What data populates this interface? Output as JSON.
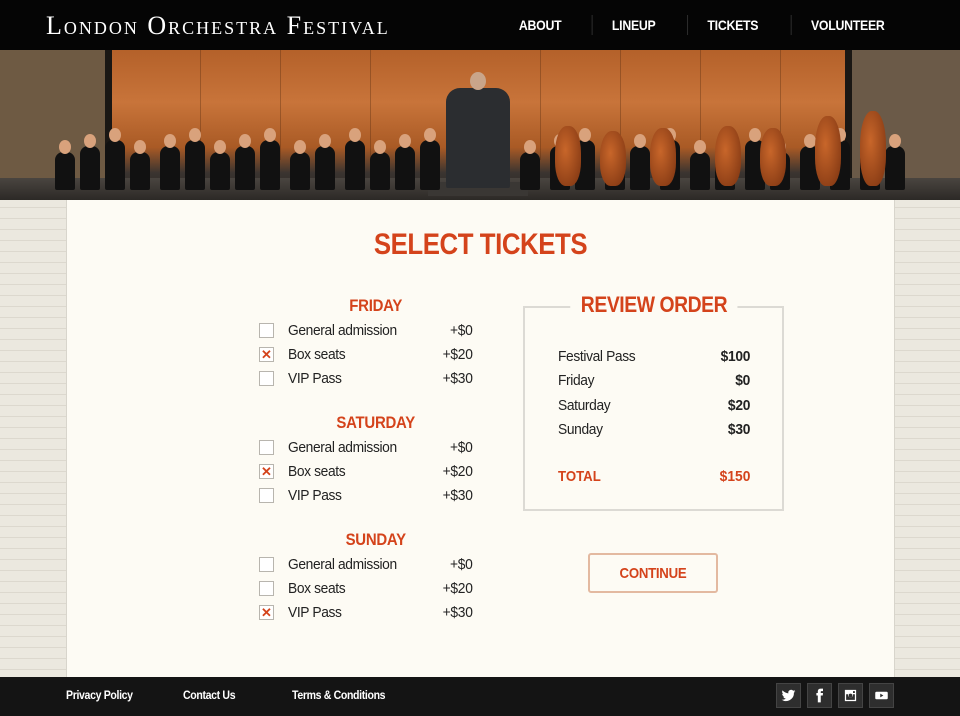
{
  "header": {
    "logo": "London Orchestra Festival",
    "nav": [
      {
        "label": "ABOUT"
      },
      {
        "label": "LINEUP"
      },
      {
        "label": "TICKETS"
      },
      {
        "label": "VOLUNTEER"
      }
    ]
  },
  "hero": {
    "image": "orchestra-performing-on-stage-photo"
  },
  "main": {
    "title": "SELECT TICKETS",
    "days": [
      {
        "name": "FRIDAY",
        "options": [
          {
            "label": "General admission",
            "price": "+$0",
            "checked": false
          },
          {
            "label": "Box seats",
            "price": "+$20",
            "checked": true
          },
          {
            "label": "VIP Pass",
            "price": "+$30",
            "checked": false
          }
        ]
      },
      {
        "name": "SATURDAY",
        "options": [
          {
            "label": "General admission",
            "price": "+$0",
            "checked": false
          },
          {
            "label": "Box seats",
            "price": "+$20",
            "checked": true
          },
          {
            "label": "VIP Pass",
            "price": "+$30",
            "checked": false
          }
        ]
      },
      {
        "name": "SUNDAY",
        "options": [
          {
            "label": "General admission",
            "price": "+$0",
            "checked": false
          },
          {
            "label": "Box seats",
            "price": "+$20",
            "checked": false
          },
          {
            "label": "VIP Pass",
            "price": "+$30",
            "checked": true
          }
        ]
      }
    ],
    "review": {
      "title": "REVIEW ORDER",
      "rows": [
        {
          "label": "Festival Pass",
          "value": "$100"
        },
        {
          "label": "Friday",
          "value": "$0"
        },
        {
          "label": "Saturday",
          "value": "$20"
        },
        {
          "label": "Sunday",
          "value": "$30"
        }
      ],
      "total_label": "TOTAL",
      "total_value": "$150"
    },
    "continue_label": "CONTINUE"
  },
  "footer": {
    "links": [
      {
        "label": "Privacy Policy"
      },
      {
        "label": "Contact Us"
      },
      {
        "label": "Terms & Conditions"
      }
    ],
    "socials": [
      "twitter",
      "facebook",
      "instagram",
      "youtube"
    ]
  },
  "colors": {
    "accent": "#d4431b",
    "page_bg": "#fdfbf4",
    "header_bg": "#050505",
    "footer_bg": "#141414"
  }
}
